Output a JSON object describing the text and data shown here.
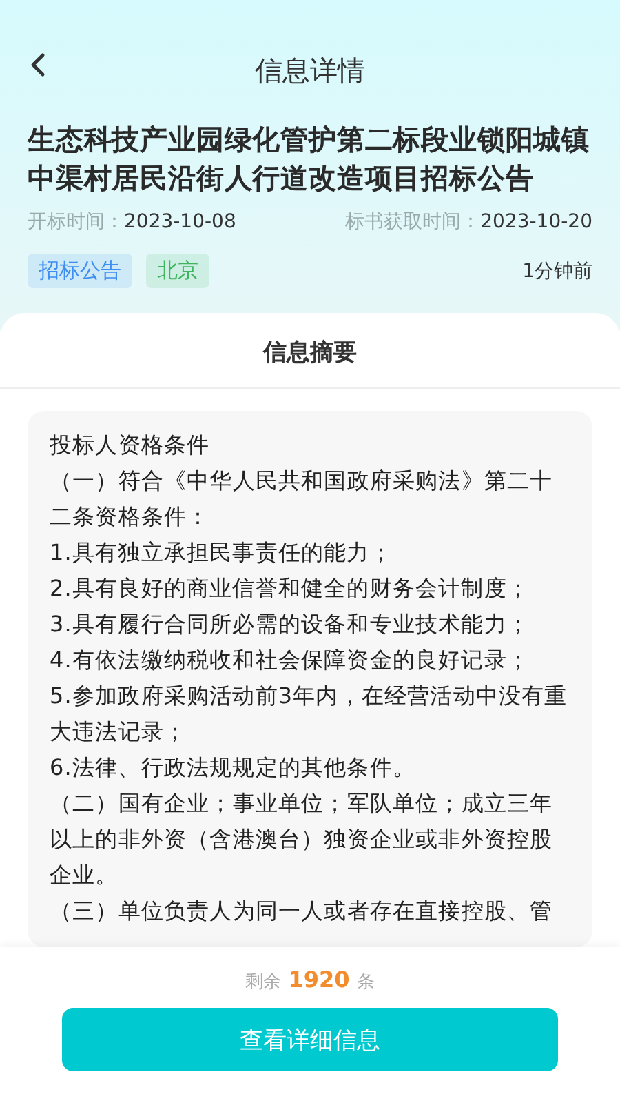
{
  "header": {
    "title": "信息详情"
  },
  "notice": {
    "title": "生态科技产业园绿化管护第二标段业锁阳城镇中渠村居民沿街人行道改造项目招标公告",
    "dates": [
      {
        "label": "开标时间：",
        "value": "2023-10-08"
      },
      {
        "label": "标书获取时间：",
        "value": "2023-10-20"
      }
    ],
    "tags": [
      {
        "text": "招标公告",
        "color": "#3d8ef0"
      },
      {
        "text": "北京",
        "color": "#3fb45f"
      }
    ],
    "time_ago": "1分钟前"
  },
  "summary": {
    "heading": "信息摘要",
    "paragraphs": [
      "投标人资格条件",
      "（一）符合《中华人民共和国政府采购法》第二十二条资格条件：",
      "1.具有独立承担民事责任的能力；",
      "2.具有良好的商业信誉和健全的财务会计制度；",
      "3.具有履行合同所必需的设备和专业技术能力；",
      "4.有依法缴纳税收和社会保障资金的良好记录；",
      "5.参加政府采购活动前3年内，在经营活动中没有重大违法记录；",
      "6.法律、行政法规规定的其他条件。",
      "（二）国有企业；事业单位；军队单位；成立三年以上的非外资（含港澳台）独资企业或非外资控股企业。",
      "（三）单位负责人为同一人或者存在直接控股、管"
    ]
  },
  "footer": {
    "remaining_prefix": "剩余",
    "remaining_count": "1920",
    "remaining_suffix": "条",
    "button": "查看详细信息"
  }
}
